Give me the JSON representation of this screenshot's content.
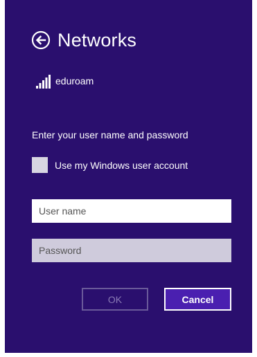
{
  "header": {
    "title": "Networks",
    "back_icon": "back-arrow-circle-icon"
  },
  "network": {
    "name": "eduroam",
    "signal_icon": "wifi-signal-bars-icon",
    "signal_strength": "full"
  },
  "form": {
    "prompt": "Enter your user name and password",
    "windows_account_checkbox": {
      "label": "Use my Windows user account",
      "checked": false
    },
    "username": {
      "placeholder": "User name",
      "value": ""
    },
    "password": {
      "placeholder": "Password",
      "value": ""
    }
  },
  "buttons": {
    "ok_label": "OK",
    "ok_enabled": false,
    "cancel_label": "Cancel"
  },
  "colors": {
    "panel_background": "#2a0f6e",
    "accent_button": "#4a1fb0",
    "disabled_text": "#8a7bb5"
  }
}
